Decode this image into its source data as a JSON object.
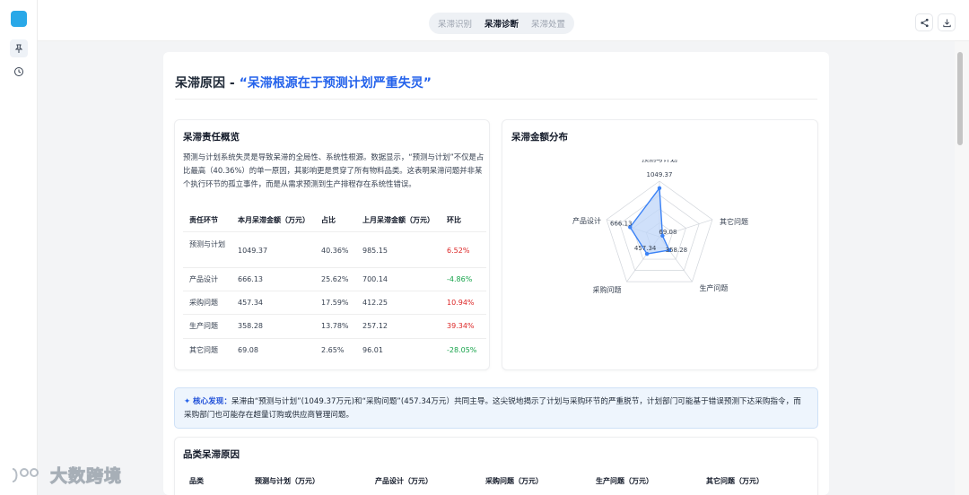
{
  "tabs": [
    {
      "label": "呆滞识别",
      "active": false
    },
    {
      "label": "呆滞诊断",
      "active": true
    },
    {
      "label": "呆滞处置",
      "active": false
    }
  ],
  "icons": {
    "rail_logo": "app-logo-icon",
    "rail_1": "pin-icon",
    "rail_2": "history-clock-icon",
    "share": "share-icon",
    "download": "download-icon"
  },
  "report": {
    "title_prefix": "呆滞原因 - ",
    "title_highlight": "“呆滞根源在于预测计划严重失灵”"
  },
  "overview": {
    "title": "呆滞责任概览",
    "paragraph": "预测与计划系统失灵是导致呆滞的全局性、系统性根源。数据显示，“预测与计划”不仅是占比最高（40.36%）的单一原因，其影响更是贯穿了所有物料品类。这表明呆滞问题并非某个执行环节的孤立事件，而是从需求预测到生产排程存在系统性错误。",
    "headers": [
      "责任环节",
      "本月呆滞金额（万元）",
      "占比",
      "上月呆滞金额（万元）",
      "环比"
    ],
    "rows": [
      {
        "name": "预测与计划",
        "amount": "1049.37",
        "share": "40.36%",
        "last": "985.15",
        "mom": "6.52%",
        "trend": "up"
      },
      {
        "name": "产品设计",
        "amount": "666.13",
        "share": "25.62%",
        "last": "700.14",
        "mom": "-4.86%",
        "trend": "down"
      },
      {
        "name": "采购问题",
        "amount": "457.34",
        "share": "17.59%",
        "last": "412.25",
        "mom": "10.94%",
        "trend": "up"
      },
      {
        "name": "生产问题",
        "amount": "358.28",
        "share": "13.78%",
        "last": "257.12",
        "mom": "39.34%",
        "trend": "up"
      },
      {
        "name": "其它问题",
        "amount": "69.08",
        "share": "2.65%",
        "last": "96.01",
        "mom": "-28.05%",
        "trend": "down"
      }
    ]
  },
  "distribution": {
    "title": "呆滞金额分布"
  },
  "chart_data": {
    "type": "radar",
    "categories": [
      "预测与计划",
      "其它问题",
      "生产问题",
      "采购问题",
      "产品设计"
    ],
    "values": [
      1049.37,
      69.08,
      358.28,
      457.34,
      666.13
    ],
    "value_labels": [
      "1049.37",
      "69.08",
      "358.28",
      "457.34",
      "666.13"
    ],
    "max": 1200,
    "levels": 4,
    "color": "#3b82f6",
    "fill": "#bfd6f8"
  },
  "insight": {
    "label": "核心发现：",
    "text": "呆滞由“预测与计划”(1049.37万元)和“采购问题”(457.34万元）共同主导。这尖锐地揭示了计划与采购环节的严重脱节，计划部门可能基于错误预测下达采购指令，而采购部门也可能存在超量订购或供应商管理问题。"
  },
  "category": {
    "title": "品类呆滞原因",
    "headers": [
      "品类",
      "预测与计划（万元）",
      "产品设计（万元）",
      "采购问题（万元）",
      "生产问题（万元）",
      "其它问题（万元）"
    ]
  },
  "watermark": "大数跨境",
  "colors": {
    "accent": "#2563eb",
    "positive": "#dc2626",
    "negative": "#16a34a"
  }
}
